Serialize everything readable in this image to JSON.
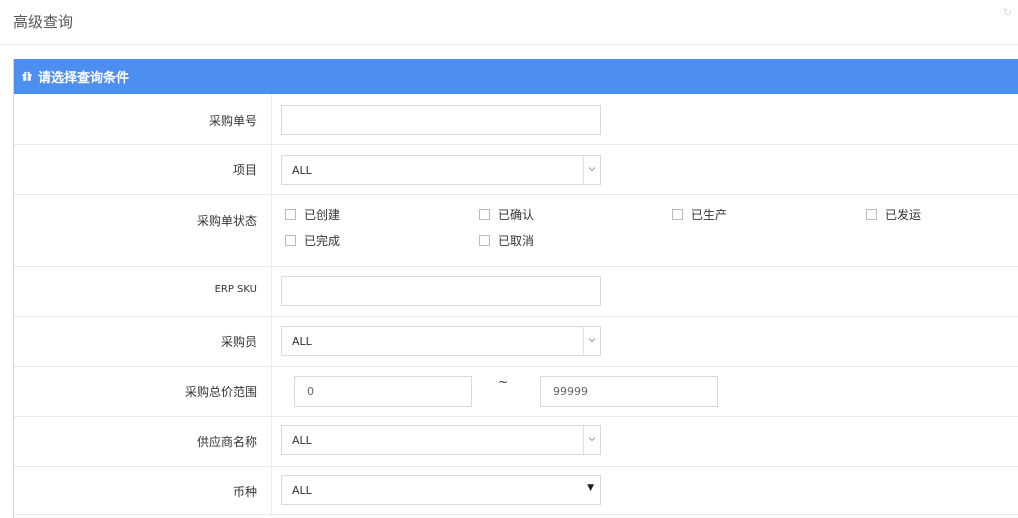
{
  "page": {
    "title": "高级查询"
  },
  "panel": {
    "heading": "请选择查询条件"
  },
  "form": {
    "purchase_no": {
      "label": "采购单号",
      "value": ""
    },
    "project": {
      "label": "项目",
      "value": "ALL"
    },
    "status": {
      "label": "采购单状态",
      "options": [
        "已创建",
        "已确认",
        "已生产",
        "已发运",
        "已完成",
        "已取消"
      ]
    },
    "erp_sku": {
      "label": "ERP SKU",
      "value": ""
    },
    "buyer": {
      "label": "采购员",
      "value": "ALL"
    },
    "price_range": {
      "label": "采购总价范围",
      "min": "0",
      "separator": "~",
      "max": "99999"
    },
    "supplier": {
      "label": "供应商名称",
      "value": "ALL"
    },
    "currency": {
      "label": "币种",
      "value": "ALL"
    }
  },
  "colors": {
    "accent": "#4d8ff0",
    "border": "#d9d9d9",
    "divider": "#e8e8e8"
  }
}
